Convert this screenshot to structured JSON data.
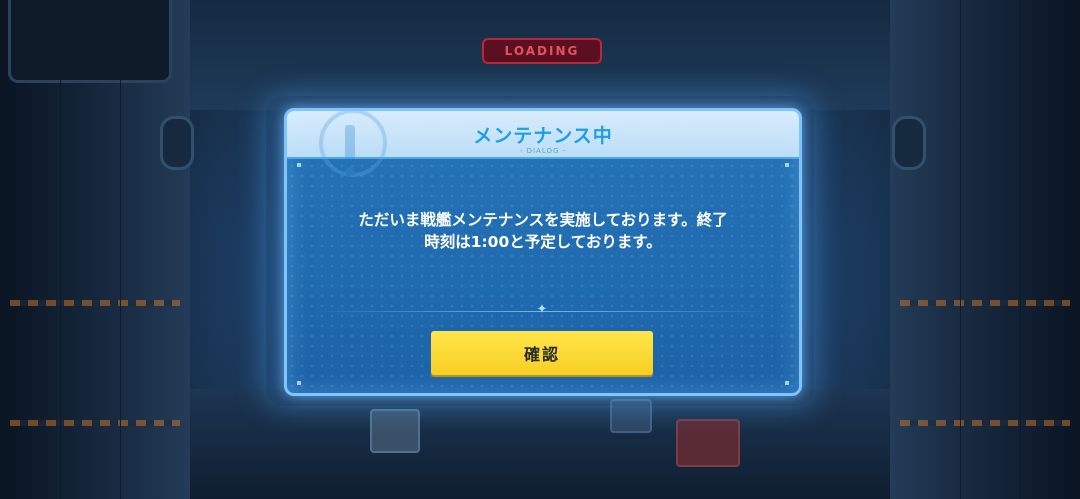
{
  "background": {
    "sign_text": "LOADING"
  },
  "dialog": {
    "title": "メンテナンス中",
    "subtitle": "- DIALOG -",
    "message_line1": "ただいま戦艦メンテナンスを実施しております。終了",
    "message_line2": "時刻は1:00と予定しております。",
    "confirm_label": "確認",
    "divider_icon": "sparkle-icon"
  },
  "colors": {
    "title": "#1f9ee8",
    "button": "#f7cf23",
    "frame": "#7fc4ff"
  }
}
